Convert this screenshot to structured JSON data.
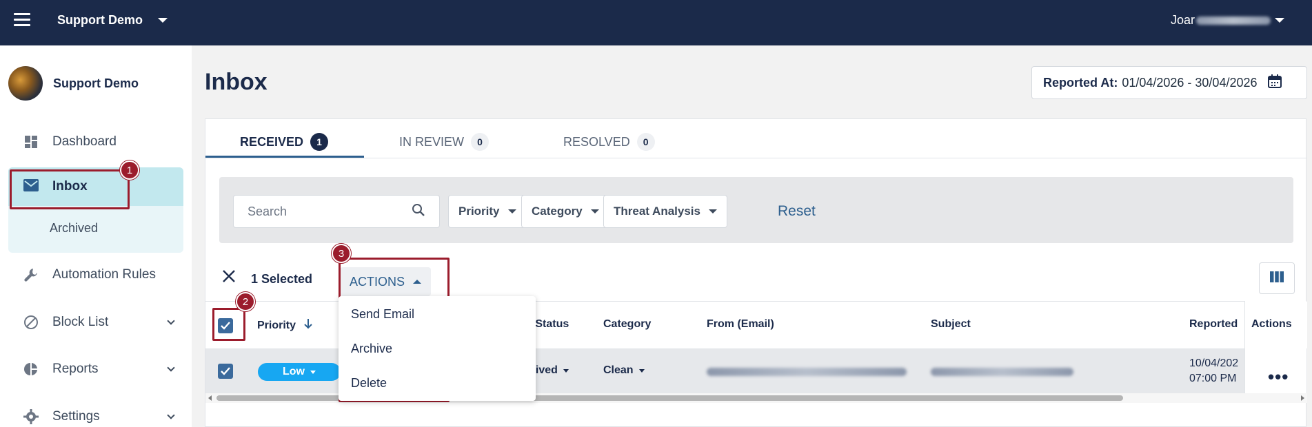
{
  "topbar": {
    "org_name": "Support Demo",
    "user_name_visible": "Joar"
  },
  "sidebar": {
    "org_name": "Support Demo",
    "items": [
      {
        "label": "Dashboard",
        "icon": "dashboard-icon"
      },
      {
        "label": "Inbox",
        "icon": "mail-icon"
      },
      {
        "label": "Archived"
      },
      {
        "label": "Automation Rules",
        "icon": "wrench-icon"
      },
      {
        "label": "Block List",
        "icon": "block-icon"
      },
      {
        "label": "Reports",
        "icon": "pie-chart-icon"
      },
      {
        "label": "Settings",
        "icon": "gear-icon"
      }
    ]
  },
  "callouts": [
    "1",
    "2",
    "3"
  ],
  "page": {
    "title": "Inbox",
    "date_label": "Reported At:",
    "date_range": "01/04/2026 - 30/04/2026"
  },
  "tabs": [
    {
      "label": "RECEIVED",
      "count": "1"
    },
    {
      "label": "IN REVIEW",
      "count": "0"
    },
    {
      "label": "RESOLVED",
      "count": "0"
    }
  ],
  "filters": {
    "search_placeholder": "Search",
    "priority": "Priority",
    "category": "Category",
    "threat_analysis": "Threat Analysis",
    "reset": "Reset"
  },
  "selection": {
    "count_label": "1 Selected",
    "actions_label": "ACTIONS",
    "menu": [
      "Send Email",
      "Archive",
      "Delete"
    ]
  },
  "table": {
    "headers": {
      "priority": "Priority",
      "status": "s Status",
      "category": "Category",
      "from": "From (Email)",
      "subject": "Subject",
      "reported": "Reported",
      "actions": "Actions"
    },
    "row": {
      "priority": "Low",
      "status": "eived",
      "category": "Clean",
      "reported_date": "10/04/202",
      "reported_time": "07:00 PM",
      "actions": "•••"
    }
  },
  "colors": {
    "topbar": "#1b2a4a",
    "accent": "#2d5f8e",
    "callout": "#9b1c2c",
    "priority_low": "#17a7f2",
    "inbox_highlight": "#c2e8ee"
  }
}
